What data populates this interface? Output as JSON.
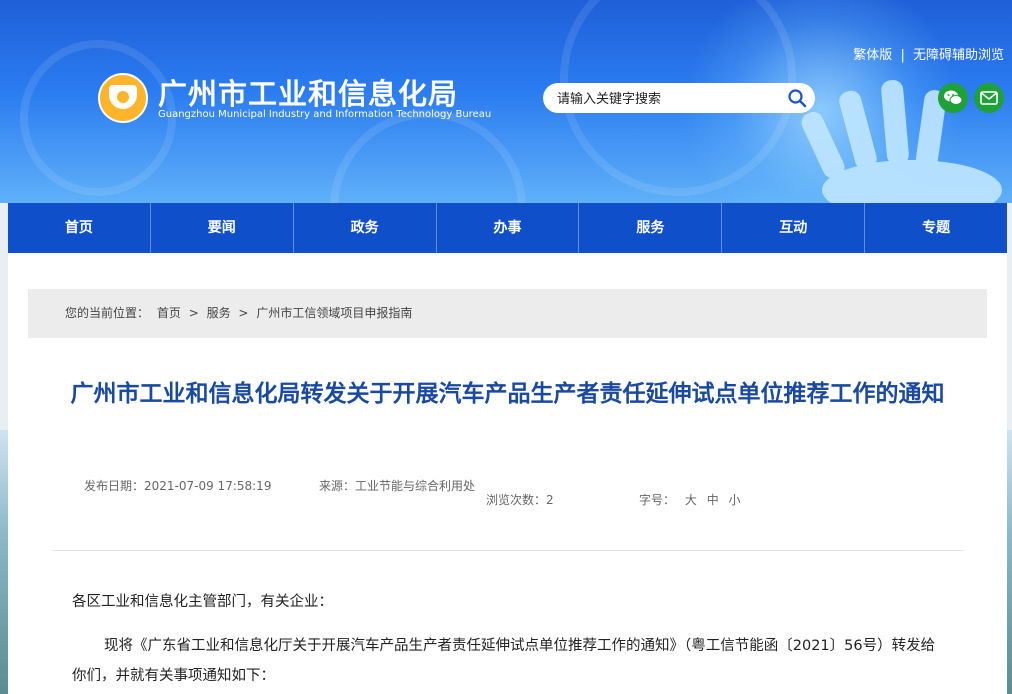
{
  "header": {
    "site_title": "广州市工业和信息化局",
    "site_subtitle": "Guangzhou Municipal Industry and Information Technology Bureau",
    "top_links": [
      "繁体版",
      "无障碍辅助浏览"
    ],
    "top_links_separator": "|",
    "search": {
      "placeholder": "请输入关键字搜索",
      "value": ""
    },
    "social_icons": [
      "wechat-icon",
      "mail-icon"
    ]
  },
  "nav": {
    "items": [
      "首页",
      "要闻",
      "政务",
      "办事",
      "服务",
      "互动",
      "专题"
    ]
  },
  "breadcrumb": {
    "prefix": "您的当前位置：",
    "items": [
      "首页",
      "服务",
      "广州市工信领域项目申报指南"
    ],
    "separator": ">"
  },
  "article": {
    "title": "广州市工业和信息化局转发关于开展汽车产品生产者责任延伸试点单位推荐工作的通知",
    "publish_date": "发布日期：2021-07-09 17:58:19",
    "source": "来源：工业节能与综合利用处",
    "views": "浏览次数：2",
    "font_size_label": "字号：",
    "font_sizes": [
      "大",
      "中",
      "小"
    ],
    "paragraphs": [
      "各区工业和信息化主管部门，有关企业：",
      "现将《广东省工业和信息化厅关于开展汽车产品生产者责任延伸试点单位推荐工作的通知》（粤工信节能函〔2021〕56号）转发给你们，并就有关事项通知如下："
    ]
  },
  "colors": {
    "banner": "#2b7cf0",
    "nav": "#0f4fc9",
    "title": "#1a4aa0",
    "logo": "#ffb52b",
    "social": "#1fa038"
  }
}
